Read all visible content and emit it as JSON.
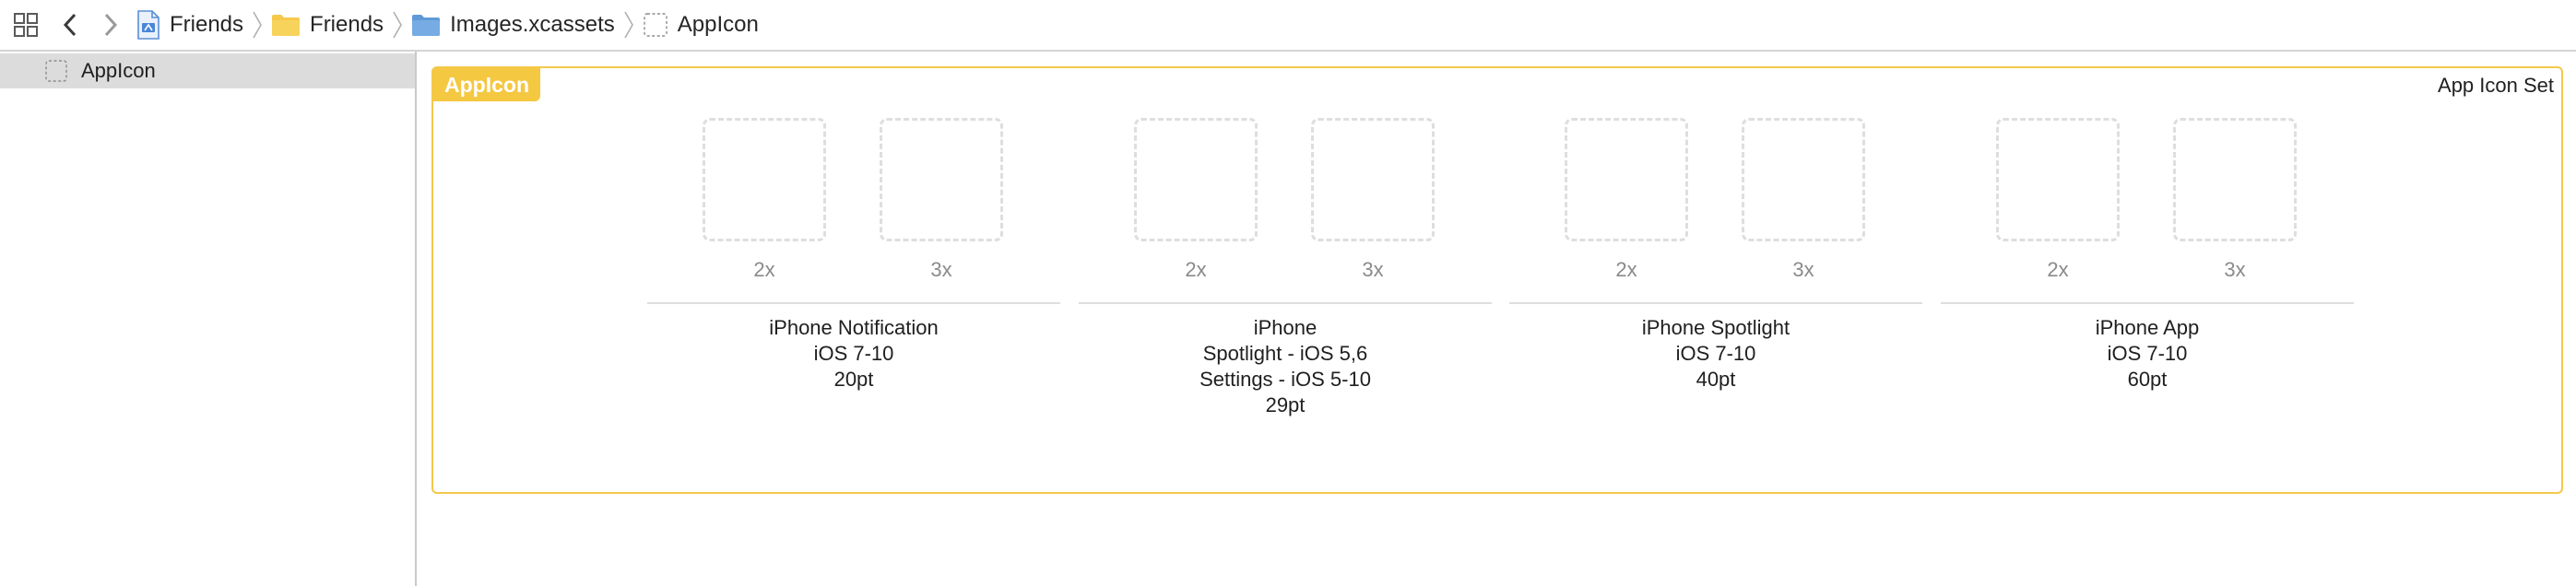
{
  "breadcrumbs": [
    {
      "label": "Friends",
      "icon": "project-file-icon"
    },
    {
      "label": "Friends",
      "icon": "yellow-folder-icon"
    },
    {
      "label": "Images.xcassets",
      "icon": "blue-folder-icon"
    },
    {
      "label": "AppIcon",
      "icon": "appicon-placeholder-icon"
    }
  ],
  "sidebar": {
    "items": [
      {
        "label": "AppIcon",
        "icon": "appicon-placeholder-icon"
      }
    ]
  },
  "editor": {
    "badge": "AppIcon",
    "set_type": "App Icon Set",
    "groups": [
      {
        "slots": [
          "2x",
          "3x"
        ],
        "title_lines": [
          "iPhone Notification",
          "iOS 7-10",
          "20pt"
        ]
      },
      {
        "slots": [
          "2x",
          "3x"
        ],
        "title_lines": [
          "iPhone",
          "Spotlight - iOS 5,6",
          "Settings - iOS 5-10",
          "29pt"
        ]
      },
      {
        "slots": [
          "2x",
          "3x"
        ],
        "title_lines": [
          "iPhone Spotlight",
          "iOS 7-10",
          "40pt"
        ]
      },
      {
        "slots": [
          "2x",
          "3x"
        ],
        "title_lines": [
          "iPhone App",
          "iOS 7-10",
          "60pt"
        ]
      }
    ]
  },
  "colors": {
    "accent": "#f5c842",
    "selection": "#dcdcdc",
    "slot_border": "#dedede"
  }
}
